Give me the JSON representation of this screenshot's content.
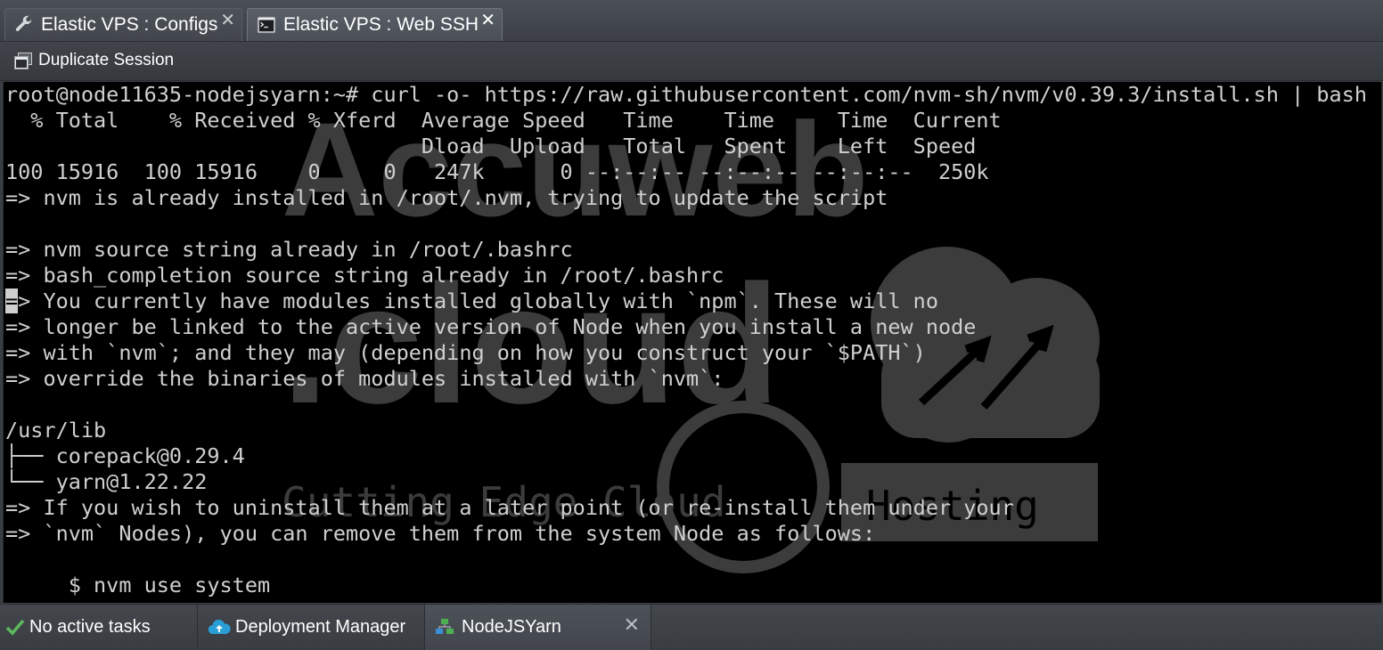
{
  "tabs": [
    {
      "label": "Elastic VPS : Configs",
      "icon": "wrench-icon",
      "active": false
    },
    {
      "label": "Elastic VPS : Web SSH",
      "icon": "terminal-icon",
      "active": true
    }
  ],
  "tab_close_glyph": "✕",
  "toolbar": {
    "duplicate_label": "Duplicate Session",
    "duplicate_icon": "duplicate-session-icon"
  },
  "terminal": {
    "lines": [
      "root@node11635-nodejsyarn:~# curl -o- https://raw.githubusercontent.com/nvm-sh/nvm/v0.39.3/install.sh | bash",
      "  % Total    % Received % Xferd  Average Speed   Time    Time     Time  Current",
      "                                 Dload  Upload   Total   Spent    Left  Speed",
      "100 15916  100 15916    0     0   247k      0 --:--:-- --:--:-- --:--:--  250k",
      "=> nvm is already installed in /root/.nvm, trying to update the script",
      "",
      "=> nvm source string already in /root/.bashrc",
      "=> bash_completion source string already in /root/.bashrc",
      "=> You currently have modules installed globally with `npm`. These will no",
      "=> longer be linked to the active version of Node when you install a new node",
      "=> with `nvm`; and they may (depending on how you construct your `$PATH`)",
      "=> override the binaries of modules installed with `nvm`:",
      "",
      "/usr/lib",
      "├── corepack@0.29.4",
      "└── yarn@1.22.22",
      "=> If you wish to uninstall them at a later point (or re-install them under your",
      "=> `nvm` Nodes), you can remove them from the system Node as follows:",
      "",
      "     $ nvm use system"
    ],
    "cursor_line": 8,
    "watermark": {
      "brand_top": "Accuweb",
      "brand_bottom": ".cloud",
      "tag_left": "Cutting Edge Cloud",
      "tag_right": "Hosting"
    }
  },
  "statusbar": {
    "tasks_label": "No active tasks",
    "tasks_icon": "checkmark-icon",
    "deploy_label": "Deployment Manager",
    "deploy_icon": "cloud-upload-icon",
    "node_label": "NodeJSYarn",
    "node_icon": "environment-icon",
    "close_glyph": "✕"
  },
  "colors": {
    "terminal_bg": "#000000",
    "terminal_fg": "#d0d0d0",
    "chrome_bg": "#3a3e44",
    "check_green": "#5cb85c",
    "cloud_blue": "#2a9fd6",
    "env_green": "#4caf50",
    "env_blue": "#3b8fd9"
  }
}
